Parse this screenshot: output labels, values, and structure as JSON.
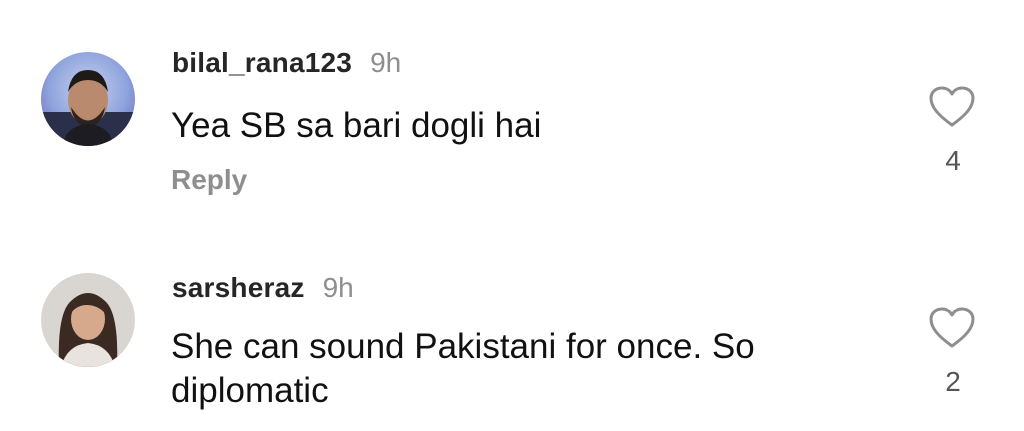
{
  "comments": [
    {
      "username": "bilal_rana123",
      "time": "9h",
      "text": "Yea SB sa bari dogli hai",
      "reply_label": "Reply",
      "likes": "4",
      "avatar_icon": "user-avatar"
    },
    {
      "username": "sarsheraz",
      "time": "9h",
      "text": "She can sound Pakistani for once. So diplomatic",
      "likes": "2",
      "avatar_icon": "user-avatar"
    }
  ],
  "icons": {
    "like": "heart-outline-icon"
  },
  "colors": {
    "username": "#262626",
    "secondary": "#8e8e8e",
    "text": "#111111"
  }
}
